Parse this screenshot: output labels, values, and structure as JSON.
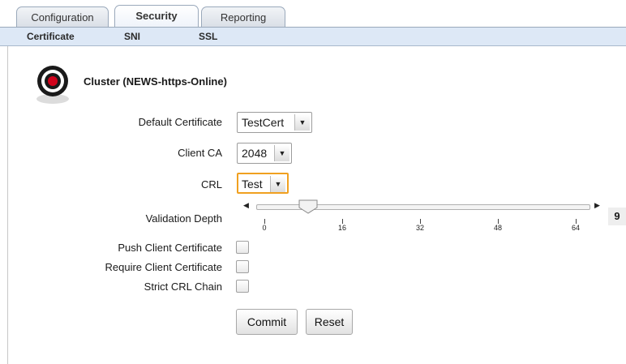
{
  "tabs": [
    {
      "label": "Configuration",
      "active": false
    },
    {
      "label": "Security",
      "active": true
    },
    {
      "label": "Reporting",
      "active": false
    }
  ],
  "subnav": {
    "items": [
      "Certificate",
      "SNI",
      "SSL"
    ]
  },
  "cluster": {
    "title": "Cluster (NEWS-https-Online)",
    "icon": "target-icon"
  },
  "form": {
    "default_certificate": {
      "label": "Default Certificate",
      "value": "TestCert"
    },
    "client_ca": {
      "label": "Client CA",
      "value": "2048"
    },
    "crl": {
      "label": "CRL",
      "value": "Test"
    },
    "validation_depth": {
      "label": "Validation Depth",
      "value": "9",
      "min": 0,
      "max": 64,
      "ticks": [
        "0",
        "16",
        "32",
        "48",
        "64"
      ]
    },
    "push_client_certificate": {
      "label": "Push Client Certificate",
      "checked": false
    },
    "require_client_certificate": {
      "label": "Require Client Certificate",
      "checked": false
    },
    "strict_crl_chain": {
      "label": "Strict CRL Chain",
      "checked": false
    }
  },
  "buttons": {
    "commit": "Commit",
    "reset": "Reset"
  },
  "colors": {
    "subnav_bg": "#dde8f6",
    "focus_border": "#f0a020",
    "target_red": "#d0021b"
  }
}
